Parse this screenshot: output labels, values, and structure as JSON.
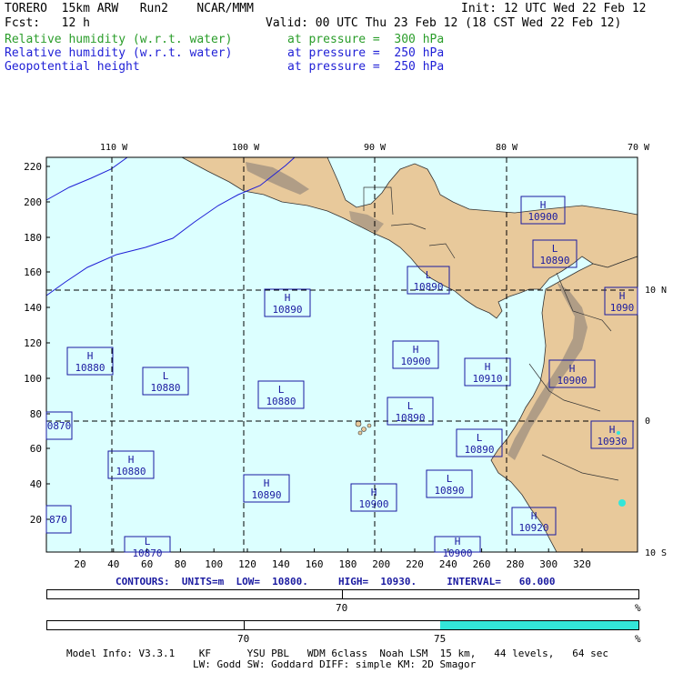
{
  "header": {
    "line1_left": "TORERO  15km ARW   Run2    NCAR/MMM",
    "line1_right": "Init: 12 UTC Wed 22 Feb 12",
    "line2_left": "Fcst:   12 h",
    "line2_right": "Valid: 00 UTC Thu 23 Feb 12 (18 CST Wed 22 Feb 12)",
    "fields": [
      {
        "name": "Relative humidity (w.r.t. water)",
        "level": "at pressure =  300 hPa",
        "color": "#2a9d2a"
      },
      {
        "name": "Relative humidity (w.r.t. water)",
        "level": "at pressure =  250 hPa",
        "color": "#1f1fd6"
      },
      {
        "name": "Geopotential height",
        "level": "at pressure =  250 hPa",
        "color": "#1f1fd6"
      }
    ]
  },
  "map": {
    "ocean_color": "#dcffff",
    "land_color": "#e8c99b",
    "mountain_color": "#8a8078",
    "box_color": "#1a1aa0",
    "top_lon_labels": [
      "110 W",
      "100 W",
      "90 W",
      "80 W",
      "70 W"
    ],
    "right_lat_labels": [
      "10 N",
      "0",
      "10 S"
    ],
    "y_axis_labels": [
      "220",
      "200",
      "180",
      "160",
      "140",
      "120",
      "100",
      "80",
      "60",
      "40",
      "20"
    ],
    "x_axis_labels": [
      "20",
      "40",
      "60",
      "80",
      "100",
      "120",
      "140",
      "160",
      "180",
      "200",
      "220",
      "240",
      "260",
      "280",
      "300",
      "320"
    ],
    "centers": [
      {
        "type": "H",
        "value": "10900"
      },
      {
        "type": "L",
        "value": "10890"
      },
      {
        "type": "L",
        "value": "10890"
      },
      {
        "type": "H",
        "value": "1090"
      },
      {
        "type": "H",
        "value": "10890"
      },
      {
        "type": "H",
        "value": "10880"
      },
      {
        "type": "H",
        "value": "10900"
      },
      {
        "type": "L",
        "value": "10880"
      },
      {
        "type": "H",
        "value": "10910"
      },
      {
        "type": "L",
        "value": "10880"
      },
      {
        "type": "H",
        "value": "10900"
      },
      {
        "type": "L",
        "value": "10890"
      },
      {
        "type": "",
        "value": "0870"
      },
      {
        "type": "L",
        "value": "10890"
      },
      {
        "type": "H",
        "value": "10930"
      },
      {
        "type": "H",
        "value": "10880"
      },
      {
        "type": "L",
        "value": "10890"
      },
      {
        "type": "H",
        "value": "10890"
      },
      {
        "type": "H",
        "value": "10900"
      },
      {
        "type": "",
        "value": "870"
      },
      {
        "type": "H",
        "value": "10920"
      },
      {
        "type": "L",
        "value": "10870"
      },
      {
        "type": "H",
        "value": "10900"
      }
    ]
  },
  "contours": {
    "text": "CONTOURS:  UNITS=m  LOW=  10800.     HIGH=  10930.     INTERVAL=   60.000"
  },
  "colorbar_green": {
    "tick_label": "70",
    "unit": "%",
    "fill_color": "#ffffff"
  },
  "colorbar_blue": {
    "tick_labels": [
      "70",
      "75"
    ],
    "unit": "%",
    "fill_color": "#33e6d9",
    "fill_start_percent": 75
  },
  "footer": {
    "line1": "Model Info: V3.3.1    KF      YSU PBL   WDM 6class  Noah LSM  15 km,   44 levels,   64 sec",
    "line2": "LW: Godd SW: Goddard DIFF: simple KM: 2D Smagor"
  }
}
